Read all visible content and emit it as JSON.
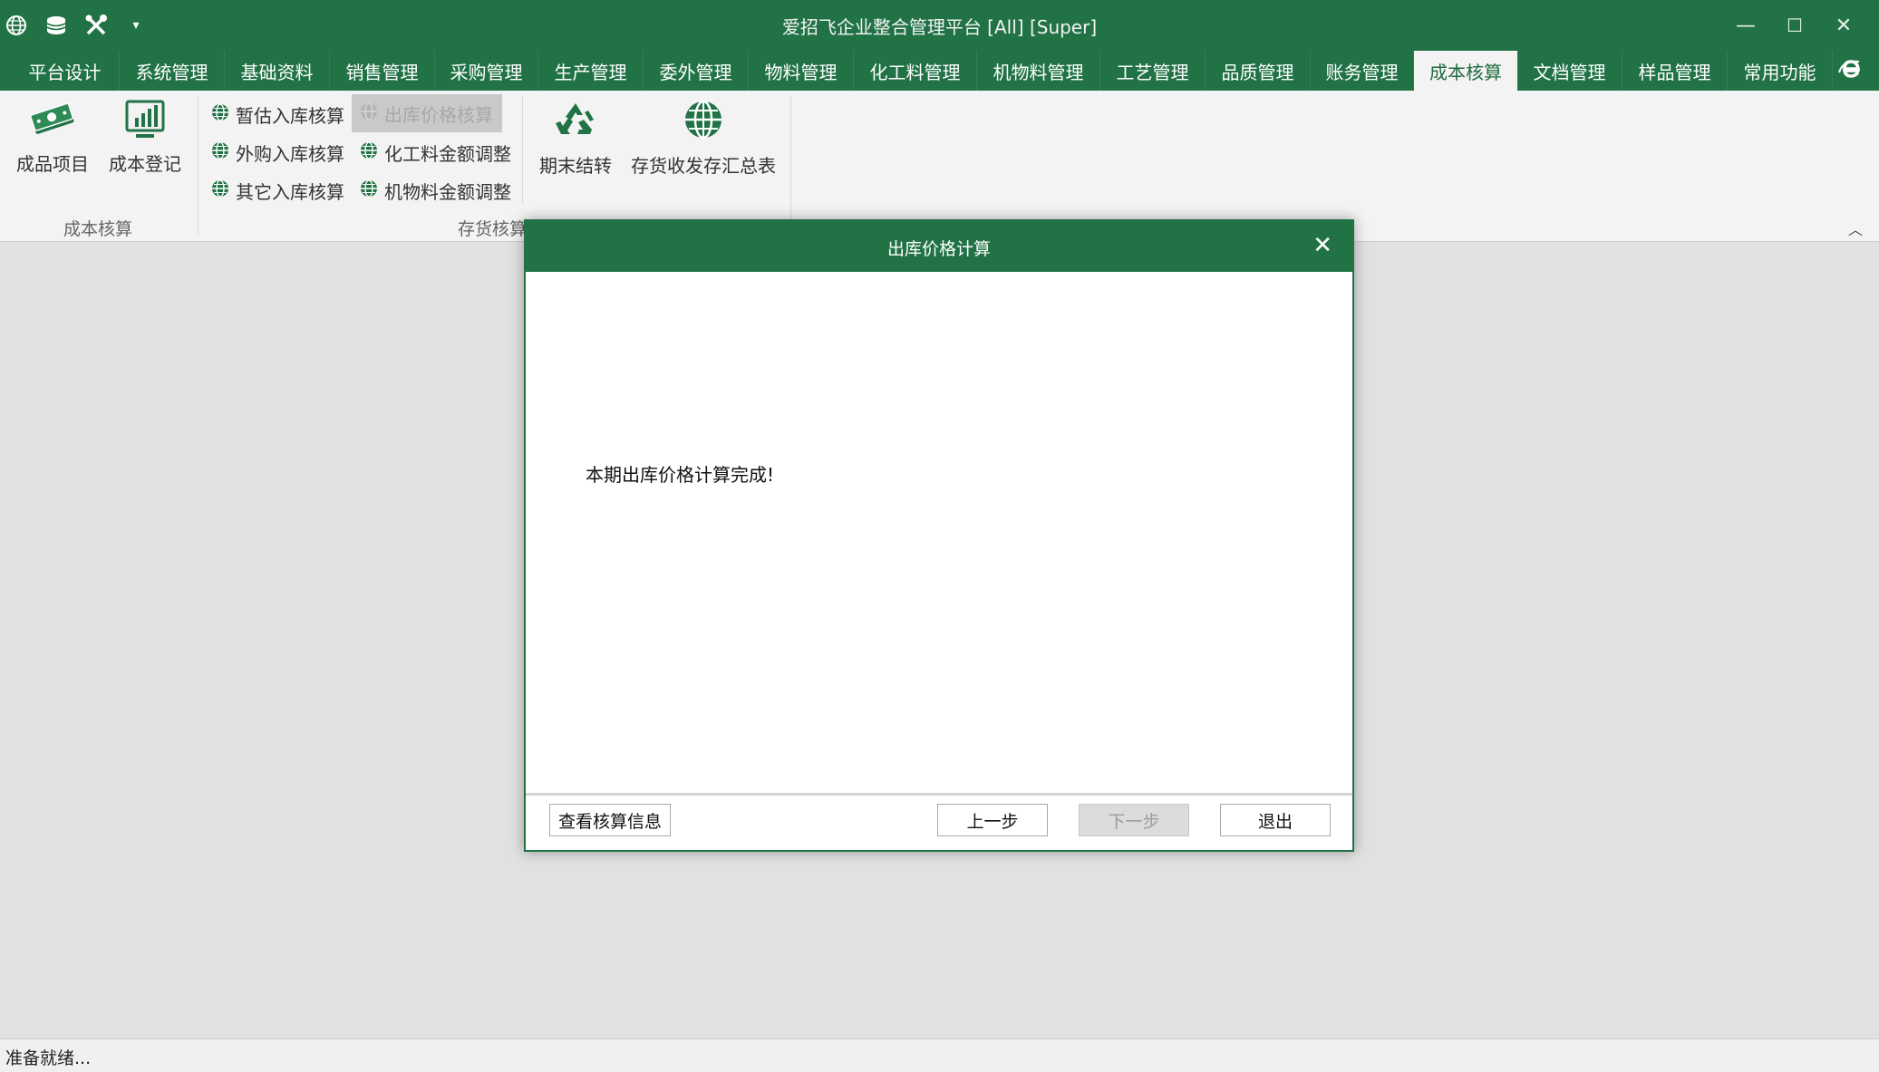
{
  "window": {
    "title": "爱招飞企业整合管理平台 [All] [Super]",
    "minimize_label": "—",
    "maximize_label": "☐",
    "close_label": "✕"
  },
  "quick_access": {
    "icons": [
      "globe-icon",
      "database-icon",
      "tools-icon",
      "customize-dropdown-icon"
    ],
    "dropdown_label": "▾"
  },
  "tabs": [
    {
      "label": "平台设计"
    },
    {
      "label": "系统管理"
    },
    {
      "label": "基础资料"
    },
    {
      "label": "销售管理"
    },
    {
      "label": "采购管理"
    },
    {
      "label": "生产管理"
    },
    {
      "label": "委外管理"
    },
    {
      "label": "物料管理"
    },
    {
      "label": "化工料管理"
    },
    {
      "label": "机物料管理"
    },
    {
      "label": "工艺管理"
    },
    {
      "label": "品质管理"
    },
    {
      "label": "账务管理"
    },
    {
      "label": "成本核算",
      "active": true
    },
    {
      "label": "文档管理"
    },
    {
      "label": "样品管理"
    },
    {
      "label": "常用功能"
    }
  ],
  "ribbon": {
    "groups": [
      {
        "label": "成本核算",
        "buttons": [
          {
            "label": "成品项目",
            "icon": "money-icon"
          },
          {
            "label": "成本登记",
            "icon": "chart-icon"
          }
        ]
      },
      {
        "label": "存货核算",
        "small_buttons": [
          {
            "label": "暂估入库核算",
            "icon": "globe-icon"
          },
          {
            "label": "出库价格核算",
            "icon": "globe-icon",
            "disabled": true
          },
          {
            "label": "外购入库核算",
            "icon": "globe-icon"
          },
          {
            "label": "化工料金额调整",
            "icon": "globe-icon"
          },
          {
            "label": "其它入库核算",
            "icon": "globe-icon"
          },
          {
            "label": "机物料金额调整",
            "icon": "globe-icon"
          }
        ],
        "buttons": [
          {
            "label": "期末结转",
            "icon": "recycle-icon"
          },
          {
            "label": "存货收发存汇总表",
            "icon": "globe-icon"
          }
        ]
      }
    ],
    "collapse_label": "︿"
  },
  "dialog": {
    "title": "出库价格计算",
    "close_label": "✕",
    "message": "本期出库价格计算完成!",
    "buttons": {
      "view_info": "查看核算信息",
      "prev": "上一步",
      "next": "下一步",
      "exit": "退出"
    }
  },
  "status_bar": {
    "text": "准备就绪..."
  },
  "colors": {
    "accent": "#217346",
    "ribbon_bg": "#f3f3f3",
    "workspace_bg": "#e1e1e1"
  }
}
